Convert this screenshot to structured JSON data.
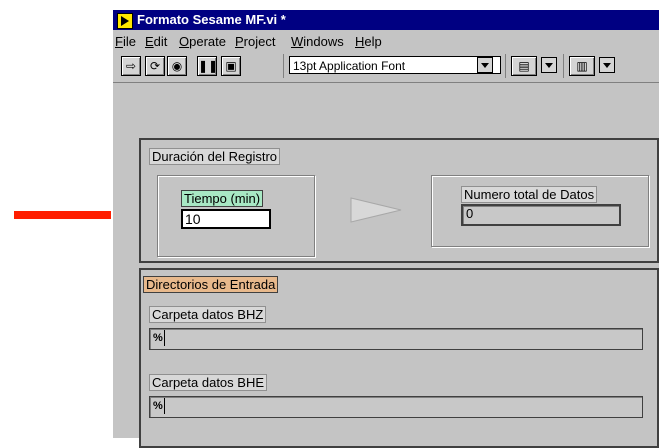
{
  "window": {
    "title": "Formato Sesame MF.vi *"
  },
  "menu": {
    "items": [
      {
        "label": "File",
        "u": "F",
        "rest": "ile"
      },
      {
        "label": "Edit",
        "u": "E",
        "rest": "dit"
      },
      {
        "label": "Operate",
        "u": "O",
        "rest": "perate"
      },
      {
        "label": "Project",
        "u": "P",
        "rest": "roject"
      },
      {
        "label": "Windows",
        "u": "W",
        "rest": "indows"
      },
      {
        "label": "Help",
        "u": "H",
        "rest": "elp"
      }
    ]
  },
  "toolbar": {
    "font": "13pt Application Font"
  },
  "duracion": {
    "title": "Duración del Registro",
    "tiempo_label": "Tiempo (min)",
    "tiempo_value": "10",
    "total_label": "Numero total de Datos",
    "total_value": "0"
  },
  "directorios": {
    "title": "Directorios de Entrada",
    "bhz_label": "Carpeta datos BHZ",
    "bhe_label": "Carpeta datos BHE"
  },
  "colors": {
    "titlebar": "#000082",
    "arrow": "#ff1e00",
    "tiempo_label_bg": "#a8e8c4",
    "dir_label_bg": "#e8b98c"
  },
  "icons": [
    "vi-icon",
    "run-icon",
    "run-continuously-icon",
    "abort-icon",
    "pause-icon",
    "align-icon",
    "distribute-icon",
    "red-arrow-icon",
    "wire-arrow-icon",
    "path-icon"
  ]
}
